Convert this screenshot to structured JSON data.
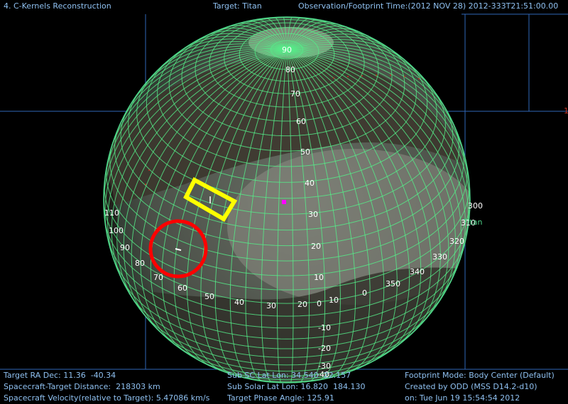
{
  "header": {
    "window_title": "4. C-Kernels Reconstruction",
    "target": "Target: Titan",
    "obs_time": "Observation/Footprint Time:(2012 NOV 28) 2012-333T21:51:00.00"
  },
  "globe": {
    "target_name": "Titan",
    "edge_label": "1",
    "lat_labels": [
      "90",
      "80",
      "70",
      "60",
      "50",
      "40",
      "30",
      "20",
      "10",
      "0",
      "-10",
      "-20",
      "-30",
      "-40"
    ],
    "lon_labels": [
      "110",
      "100",
      "90",
      "80",
      "70",
      "60",
      "50",
      "40",
      "30",
      "20",
      "10",
      "0",
      "350",
      "340",
      "330",
      "320",
      "310",
      "300"
    ],
    "boresight_color": "#ff00ff",
    "footprint_rect_color": "#ffff00",
    "footprint_circle_color": "#ff0000",
    "grid_color": "#55ee88"
  },
  "footer": {
    "ra_dec": "Target RA Dec: 11.36  -40.34",
    "distance": "Spacecraft-Target Distance:  218303 km",
    "velocity": "Spacecraft Velocity(relative to Target): 5.47086 km/s",
    "sub_sc": "Sub SC Lat Lon: 34.540  22.157",
    "sub_solar": "Sub Solar Lat Lon: 16.820  184.130",
    "phase": "Target Phase Angle: 125.91",
    "footprint_mode": "Footprint Mode: Body Center (Default)",
    "created_by": "Created by ODD (MSS D14.2-d10)",
    "created_on": "on: Tue Jun 19 15:54:54 2012"
  }
}
